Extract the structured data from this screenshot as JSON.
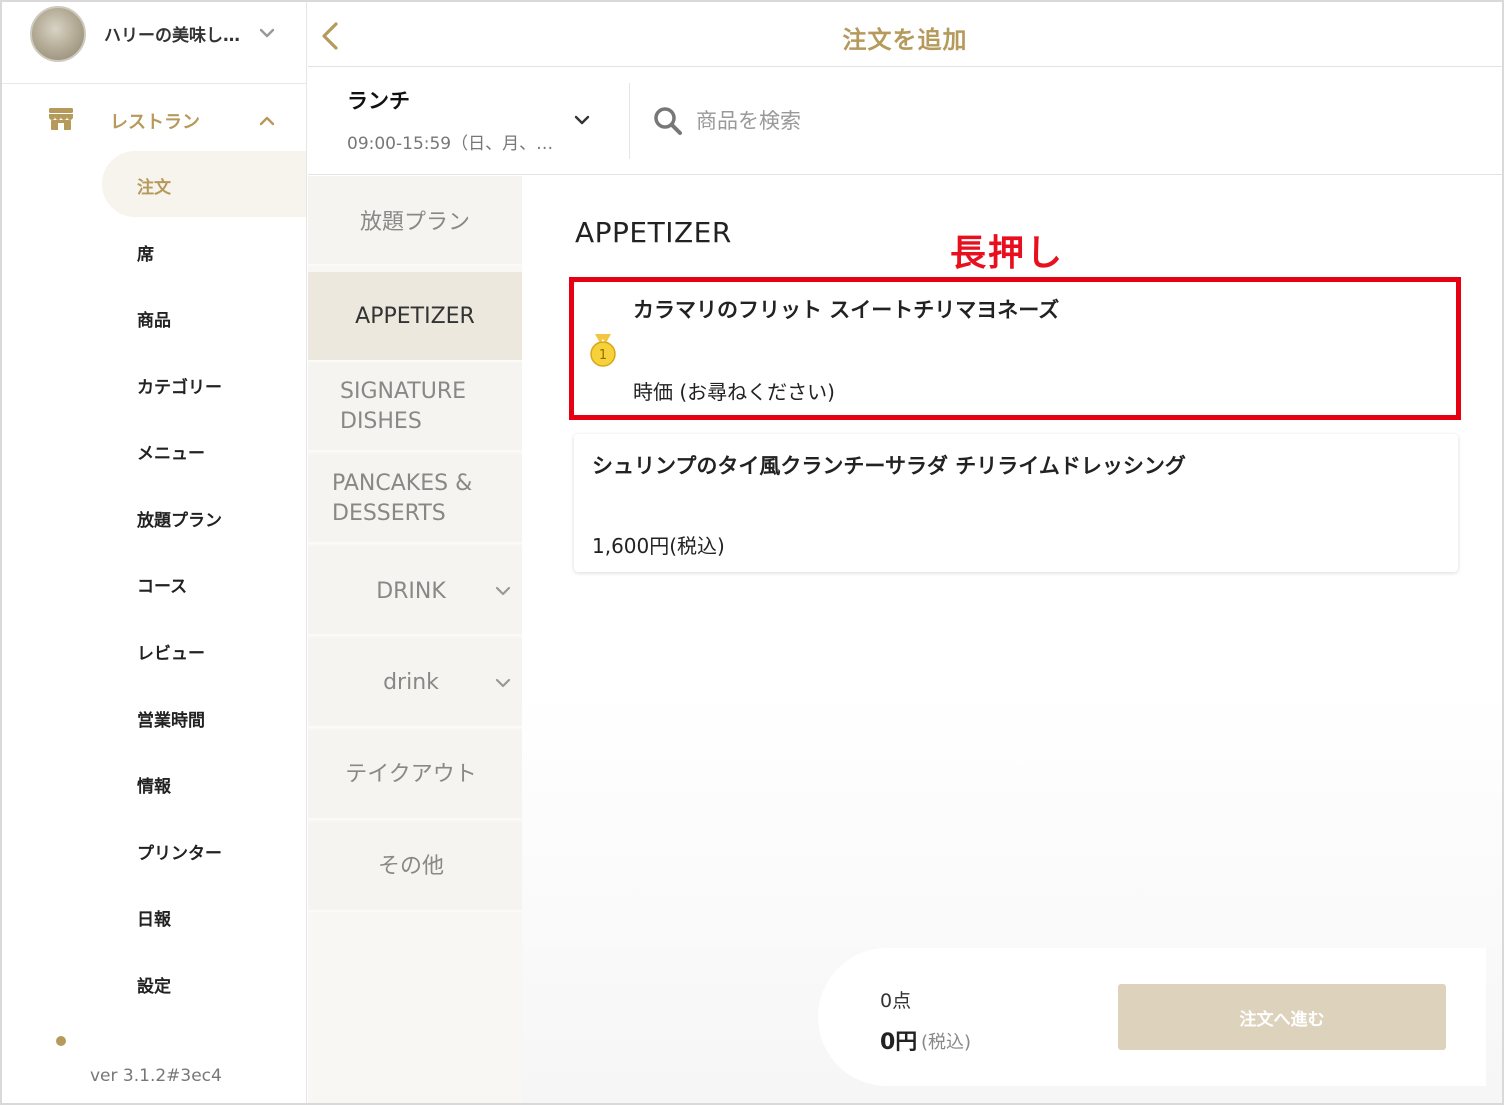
{
  "store": {
    "name": "ハリーの美味し…"
  },
  "sidebar": {
    "group_label": "レストラン",
    "items": [
      {
        "label": "注文",
        "active": true
      },
      {
        "label": "席"
      },
      {
        "label": "商品"
      },
      {
        "label": "カテゴリー"
      },
      {
        "label": "メニュー"
      },
      {
        "label": "放題プラン"
      },
      {
        "label": "コース"
      },
      {
        "label": "レビュー"
      },
      {
        "label": "営業時間"
      },
      {
        "label": "情報"
      },
      {
        "label": "プリンター"
      },
      {
        "label": "日報"
      },
      {
        "label": "設定"
      }
    ],
    "version": "ver 3.1.2#3ec4"
  },
  "header": {
    "title": "注文を追加"
  },
  "menu_select": {
    "name": "ランチ",
    "hours": "09:00-15:59（日、月、…"
  },
  "search": {
    "placeholder": "商品を検索"
  },
  "categories": [
    {
      "label": "放題プラン"
    },
    {
      "label": "APPETIZER",
      "active": true
    },
    {
      "label": "SIGNATURE DISHES"
    },
    {
      "label": "PANCAKES & DESSERTS"
    },
    {
      "label": "DRINK",
      "expandable": true
    },
    {
      "label": "drink",
      "expandable": true
    },
    {
      "label": "テイクアウト"
    },
    {
      "label": "その他"
    }
  ],
  "content": {
    "section_title": "APPETIZER",
    "annotation": "長押し",
    "items": [
      {
        "name": "カラマリのフリット スイートチリマヨネーズ",
        "price": "時価 (お尋ねください)",
        "badge": "1"
      },
      {
        "name": "シュリンプのタイ風クランチーサラダ チリライムドレッシング",
        "price": "1,600円(税込)"
      }
    ]
  },
  "cart": {
    "count": "0点",
    "total": "0円",
    "tax_note": "(税込)",
    "checkout_label": "注文へ進む"
  },
  "colors": {
    "accent": "#b59a5c",
    "annotation": "#e60012",
    "checkout_disabled": "#ddd3bd"
  }
}
